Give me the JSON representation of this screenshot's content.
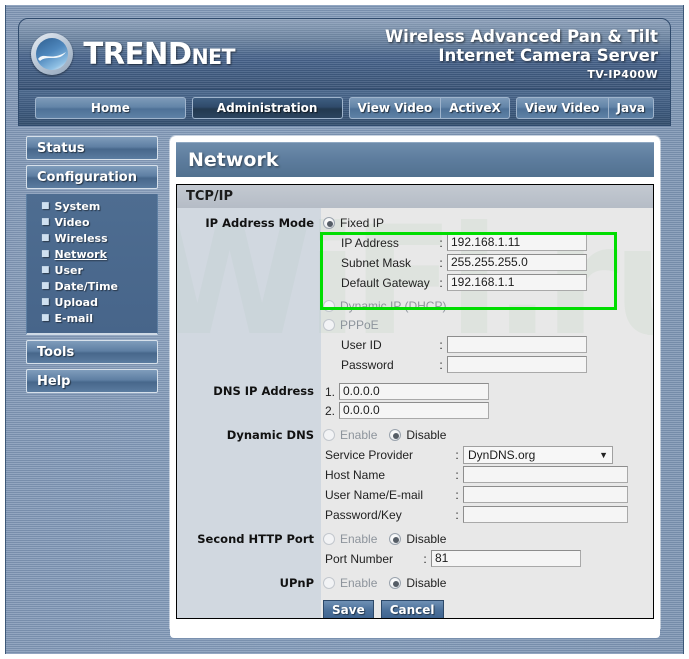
{
  "brand": {
    "logo_text_main": "TREND",
    "logo_text_sub": "net",
    "logo_icon": "trendnet-swoosh-logo-icon",
    "product_line1": "Wireless Advanced Pan & Tilt",
    "product_line2": "Internet Camera Server",
    "model": "TV-IP400W"
  },
  "nav": {
    "items": [
      {
        "label": "Home",
        "active": false
      },
      {
        "label": "Administration",
        "active": true
      }
    ],
    "video_buttons": [
      {
        "left": "View Video",
        "right": "ActiveX"
      },
      {
        "left": "View Video",
        "right": "Java"
      }
    ]
  },
  "sidebar": {
    "status_label": "Status",
    "configuration_label": "Configuration",
    "config_items": [
      {
        "label": "System",
        "active": false
      },
      {
        "label": "Video",
        "active": false
      },
      {
        "label": "Wireless",
        "active": false
      },
      {
        "label": "Network",
        "active": true
      },
      {
        "label": "User",
        "active": false
      },
      {
        "label": "Date/Time",
        "active": false
      },
      {
        "label": "Upload",
        "active": false
      },
      {
        "label": "E-mail",
        "active": false
      }
    ],
    "tools_label": "Tools",
    "help_label": "Help"
  },
  "content": {
    "page_title": "Network",
    "panel_title": "TCP/IP",
    "watermark_text": "WiFi.ru"
  },
  "form": {
    "ip_address_mode": {
      "label": "IP Address Mode",
      "fixed_ip": {
        "label": "Fixed IP",
        "selected": true
      },
      "ip_address": {
        "label": "IP Address",
        "colon": ":",
        "value": "192.168.1.11"
      },
      "subnet_mask": {
        "label": "Subnet Mask",
        "colon": ":",
        "value": "255.255.255.0"
      },
      "default_gateway": {
        "label": "Default Gateway",
        "colon": ":",
        "value": "192.168.1.1"
      },
      "dynamic_ip": {
        "label": "Dynamic IP (DHCP)",
        "selected": false
      },
      "pppoe": {
        "label": "PPPoE",
        "selected": false
      },
      "user_id": {
        "label": "User ID",
        "colon": ":",
        "value": ""
      },
      "password": {
        "label": "Password",
        "colon": ":",
        "value": ""
      }
    },
    "dns_ip_address": {
      "label": "DNS IP Address",
      "rows": [
        {
          "num": "1.",
          "value": "0.0.0.0"
        },
        {
          "num": "2.",
          "value": "0.0.0.0"
        }
      ]
    },
    "dynamic_dns": {
      "label": "Dynamic DNS",
      "enable_label": "Enable",
      "disable_label": "Disable",
      "enabled": false,
      "service_provider": {
        "label": "Service Provider",
        "colon": ":",
        "value": "DynDNS.org"
      },
      "host_name": {
        "label": "Host Name",
        "colon": ":",
        "value": ""
      },
      "user_name_email": {
        "label": "User Name/E-mail",
        "colon": ":",
        "value": ""
      },
      "password_key": {
        "label": "Password/Key",
        "colon": ":",
        "value": ""
      }
    },
    "second_http_port": {
      "label": "Second HTTP Port",
      "enable_label": "Enable",
      "disable_label": "Disable",
      "enabled": false,
      "port_number": {
        "label": "Port Number",
        "colon": ":",
        "value": "81"
      }
    },
    "upnp": {
      "label": "UPnP",
      "enable_label": "Enable",
      "disable_label": "Disable",
      "enabled": false
    },
    "buttons": {
      "save": "Save",
      "cancel": "Cancel"
    }
  },
  "annotations": {
    "highlight_color": "#00dd00",
    "highlight_target": "fixed-ip-settings-group"
  }
}
